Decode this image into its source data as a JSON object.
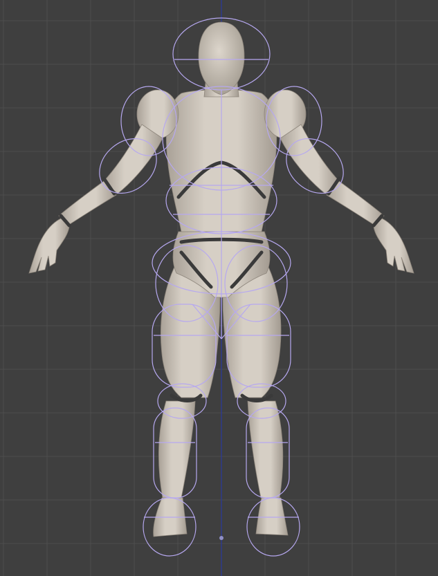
{
  "viewport": {
    "background_color": "#3f3f3f",
    "grid_color": "#4d4d4d",
    "axis_color": "#2f3a8c",
    "origin_marker_color": "#8f8fc8"
  },
  "model": {
    "skin_color": "#d2cbc1",
    "skin_shadow_color": "#9c948a",
    "joint_color": "#3a3a3a",
    "collider_wire_color": "#b6a8f0"
  }
}
